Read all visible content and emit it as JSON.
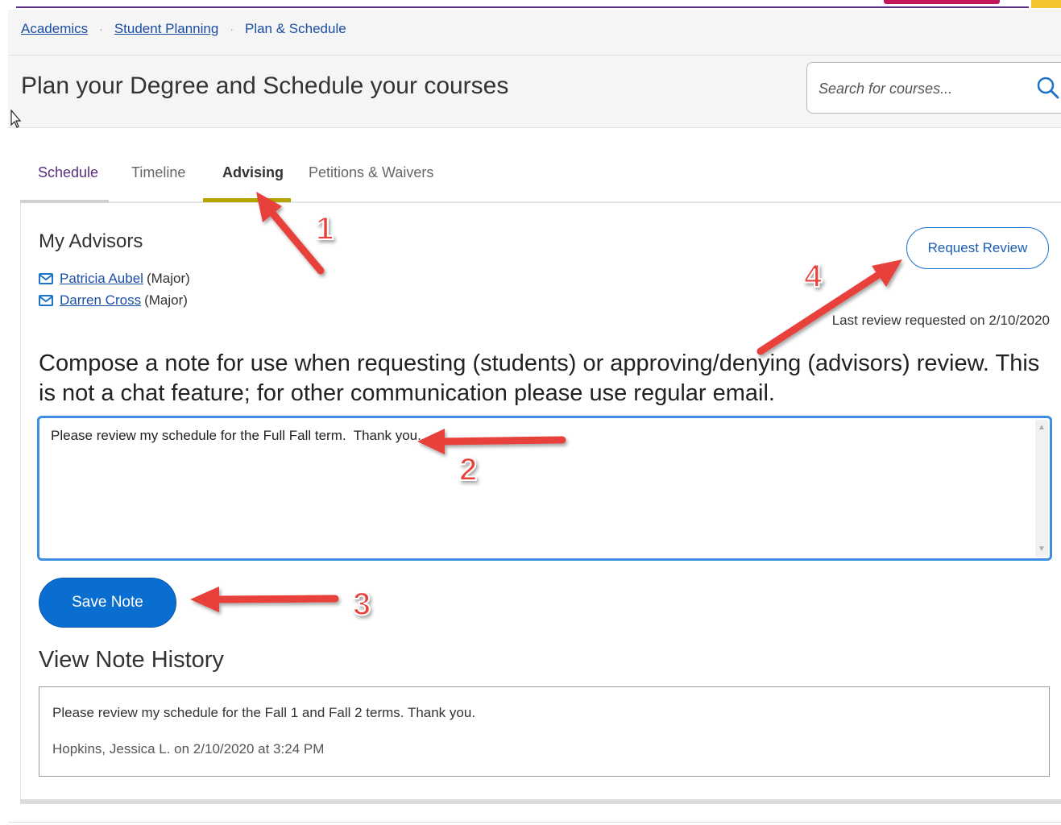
{
  "breadcrumb": {
    "items": [
      "Academics",
      "Student Planning",
      "Plan & Schedule"
    ],
    "separator": "·"
  },
  "header": {
    "title": "Plan your Degree and Schedule your courses",
    "search_placeholder": "Search for courses..."
  },
  "tabs": {
    "items": [
      "Schedule",
      "Timeline",
      "Advising",
      "Petitions & Waivers"
    ],
    "selected": "Advising"
  },
  "advisors": {
    "title": "My Advisors",
    "list": [
      {
        "name": "Patricia Aubel",
        "role": "(Major)"
      },
      {
        "name": "Darren Cross",
        "role": "(Major)"
      }
    ]
  },
  "review": {
    "button_label": "Request Review",
    "last_review": "Last review requested on 2/10/2020"
  },
  "compose": {
    "label": "Compose a note for use when requesting (students) or approving/denying (advisors) review. This is not a chat feature; for other communication please use regular email.",
    "value": "Please review my schedule for the Full Fall term.  Thank you."
  },
  "save": {
    "label": "Save Note"
  },
  "history": {
    "title": "View Note History",
    "entries": [
      {
        "text": "Please review my schedule for the Fall 1 and Fall 2 terms. Thank you.",
        "meta": "Hopkins, Jessica L. on 2/10/2020 at 3:24 PM"
      }
    ]
  },
  "annotations": {
    "labels": [
      "1",
      "2",
      "3",
      "4"
    ],
    "color": "#e8403a"
  },
  "colors": {
    "link": "#1a4ea3",
    "primary_button": "#0a6ed1",
    "tab_active_underline": "#b5a300",
    "textarea_focus": "#3c8fe0"
  }
}
